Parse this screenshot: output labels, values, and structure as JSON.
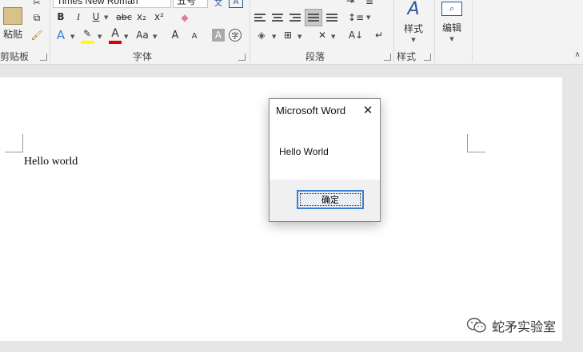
{
  "ribbon": {
    "clipboard": {
      "paste_label": "粘贴",
      "group_label": "剪贴板"
    },
    "font": {
      "font_name": "Times New Roman",
      "font_size": "五号",
      "group_label": "字体",
      "bold": "B",
      "italic": "I",
      "underline": "U",
      "strike": "abc",
      "subscript": "x₂",
      "superscript": "x²",
      "change_case": "Aa",
      "grow": "A",
      "shrink": "A",
      "char_shading": "A",
      "enclose": "字"
    },
    "paragraph": {
      "group_label": "段落"
    },
    "styles": {
      "label": "样式",
      "group_label": "样式"
    },
    "editing": {
      "label": "编辑"
    },
    "colors": {
      "highlight": "#ffff00",
      "font_color": "#e00000",
      "accent": "#2b579a"
    }
  },
  "document": {
    "body_text": "Hello world"
  },
  "dialog": {
    "title": "Microsoft Word",
    "message": "Hello World",
    "ok_label": "确定",
    "close_glyph": "✕"
  },
  "watermark": {
    "text": "蛇矛实验室"
  }
}
